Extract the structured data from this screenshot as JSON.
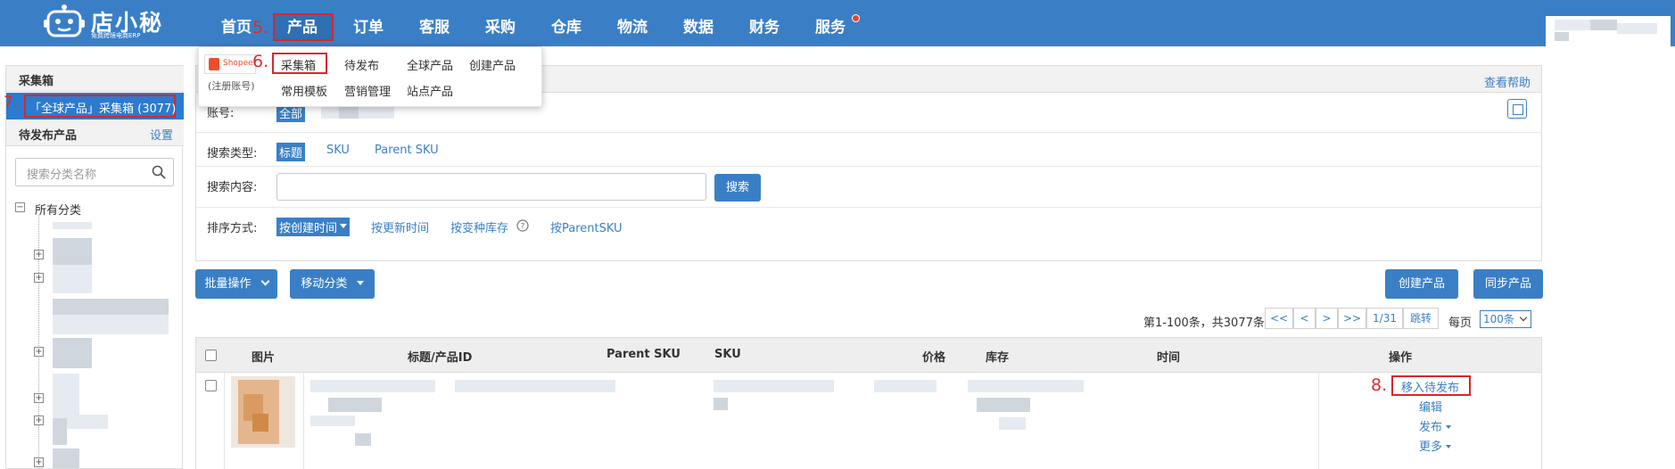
{
  "logo": {
    "name": "店小秘",
    "tagline": "免费跨境电商ERP"
  },
  "nav": {
    "items": [
      "首页",
      "产品",
      "订单",
      "客服",
      "采购",
      "仓库",
      "物流",
      "数据",
      "财务",
      "服务"
    ],
    "active": "产品"
  },
  "annotations": {
    "a5": "5.",
    "a6": "6.",
    "a7": "7.",
    "a8": "8."
  },
  "dropdown": {
    "shopee_label": "Shopee",
    "register_label": "(注册账号)",
    "row1": [
      "采集箱",
      "待发布",
      "全球产品",
      "创建产品"
    ],
    "row2": [
      "常用模板",
      "营销管理",
      "站点产品"
    ]
  },
  "sidebar": {
    "header": "采集箱",
    "active_item": "「全球产品」采集箱 (3077)",
    "pending_title": "待发布产品",
    "settings_link": "设置",
    "search_placeholder": "搜索分类名称",
    "tree_root": "所有分类"
  },
  "panel": {
    "help_link": "查看帮助",
    "account_label": "账号:",
    "account_all": "全部",
    "search_type_label": "搜索类型:",
    "search_types": [
      "标题",
      "SKU",
      "Parent SKU"
    ],
    "search_content_label": "搜索内容:",
    "search_value": "",
    "search_button": "搜索",
    "sort_label": "排序方式:",
    "sort_selected": "按创建时间",
    "sort_options": [
      "按更新时间",
      "按变种库存",
      "按ParentSKU"
    ]
  },
  "actions": {
    "batch": "批量操作",
    "move_category": "移动分类",
    "create_product": "创建产品",
    "sync_product": "同步产品"
  },
  "pagination": {
    "summary": "第1-100条，共3077条",
    "first": "<<",
    "prev": "<",
    "next": ">",
    "last": ">>",
    "page": "1/31",
    "jump": "跳转",
    "per_page_label": "每页",
    "per_page_value": "100条"
  },
  "table": {
    "headers": [
      "图片",
      "标题/产品ID",
      "Parent SKU",
      "SKU",
      "价格",
      "库存",
      "时间",
      "操作"
    ],
    "row_actions": [
      "移入待发布",
      "编辑",
      "发布",
      "更多"
    ]
  },
  "colors": {
    "nav_bg": "#3a7fc6",
    "accent": "#3a7fc6",
    "annotation": "#d9262c",
    "sidebar_active": "#2b7bd0"
  }
}
